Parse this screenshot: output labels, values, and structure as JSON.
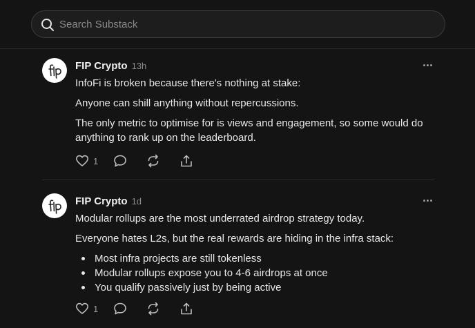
{
  "search": {
    "placeholder": "Search Substack"
  },
  "notes": [
    {
      "author": "FIP Crypto",
      "time": "13h",
      "paragraphs": [
        "InfoFi is broken because there's nothing at stake:",
        "Anyone can shill anything without repercussions.",
        "The only metric to optimise for is views and engagement, so some would do anything to rank up on the leaderboard."
      ],
      "likes": "1"
    },
    {
      "author": "FIP Crypto",
      "time": "1d",
      "paragraphs": [
        "Modular rollups are the most underrated airdrop strategy today.",
        "Everyone hates L2s, but the real rewards are hiding in the infra stack:"
      ],
      "bullets": [
        "Most infra projects are still tokenless",
        "Modular rollups expose you to 4-6 airdrops at once",
        "You qualify passively just by being active"
      ],
      "likes": "1"
    }
  ],
  "icons": {
    "search": "search-icon",
    "avatar": "fip-logo-icon",
    "more": "more-horizontal-icon",
    "like": "heart-icon",
    "comment": "comment-icon",
    "restack": "restack-icon",
    "share": "share-icon"
  },
  "colors": {
    "background": "#141414",
    "text": "#e6e6e6",
    "muted": "#8a8a8a"
  }
}
